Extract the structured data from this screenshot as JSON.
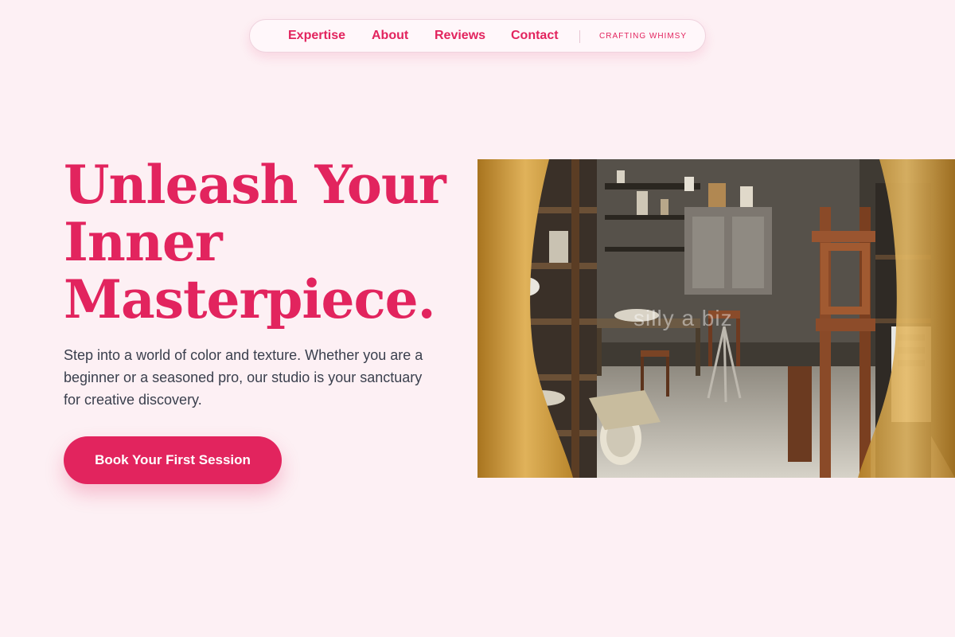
{
  "nav": {
    "links": [
      "Expertise",
      "About",
      "Reviews",
      "Contact"
    ],
    "tagline": "CRAFTING WHIMSY"
  },
  "hero": {
    "title_lines": [
      "Unleash Your",
      "Inner",
      "Masterpiece."
    ],
    "description": "Step into a world of color and texture. Whether you are a beginner or a seasoned pro, our studio is your sanctuary for creative discovery.",
    "cta_label": "Book Your First Session"
  },
  "photo": {
    "watermark": "silly   a   biz"
  },
  "colors": {
    "accent": "#e2245e",
    "background": "#fdf0f4",
    "body_text": "#3a3f4d"
  }
}
